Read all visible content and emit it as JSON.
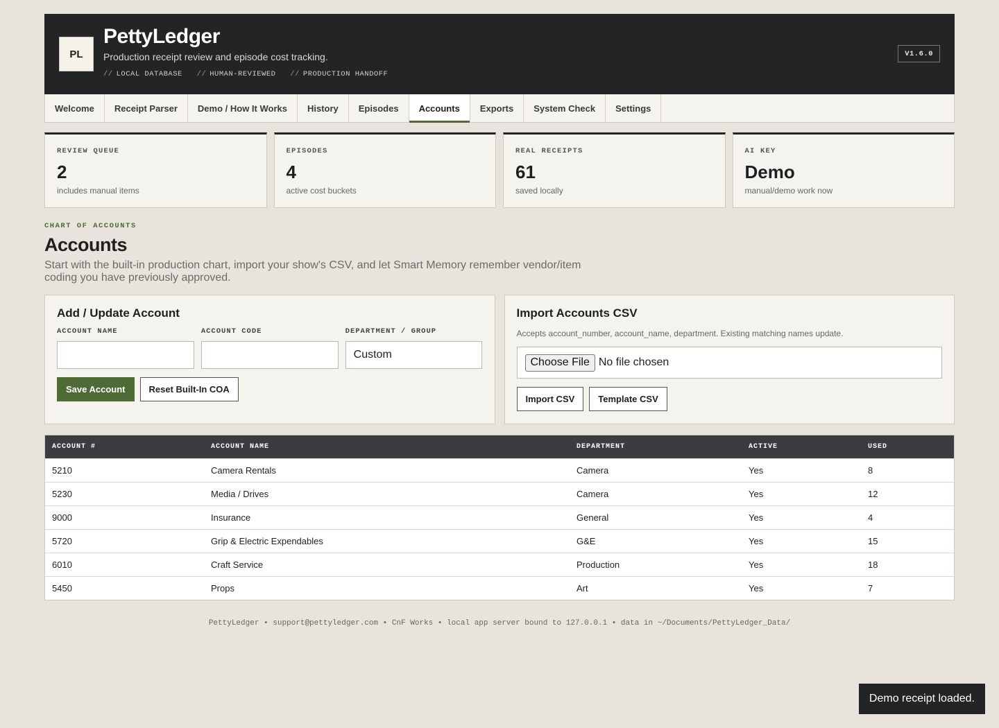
{
  "header": {
    "logo": "PL",
    "title": "PettyLedger",
    "subtitle": "Production receipt review and episode cost tracking.",
    "tags": [
      "LOCAL DATABASE",
      "HUMAN-REVIEWED",
      "PRODUCTION HANDOFF"
    ],
    "tag_prefix": "//",
    "version": "V1.6.0"
  },
  "nav": {
    "items": [
      "Welcome",
      "Receipt Parser",
      "Demo / How It Works",
      "History",
      "Episodes",
      "Accounts",
      "Exports",
      "System Check",
      "Settings"
    ],
    "active": "Accounts"
  },
  "stats": [
    {
      "label": "REVIEW QUEUE",
      "value": "2",
      "note": "includes manual items"
    },
    {
      "label": "EPISODES",
      "value": "4",
      "note": "active cost buckets"
    },
    {
      "label": "REAL RECEIPTS",
      "value": "61",
      "note": "saved locally"
    },
    {
      "label": "AI KEY",
      "value": "Demo",
      "note": "manual/demo work now"
    }
  ],
  "section": {
    "kicker": "CHART OF ACCOUNTS",
    "title": "Accounts",
    "description": "Start with the built-in production chart, import your show's CSV, and let Smart Memory remember vendor/item coding you have previously approved."
  },
  "add_panel": {
    "title": "Add / Update Account",
    "fields": [
      {
        "label": "ACCOUNT NAME",
        "value": ""
      },
      {
        "label": "ACCOUNT CODE",
        "value": ""
      },
      {
        "label": "DEPARTMENT / GROUP",
        "value": "Custom"
      }
    ],
    "save_label": "Save Account",
    "reset_label": "Reset Built-In COA"
  },
  "import_panel": {
    "title": "Import Accounts CSV",
    "note": "Accepts account_number, account_name, department. Existing matching names update.",
    "choose_label": "Choose File",
    "file_status": "No file chosen",
    "import_label": "Import CSV",
    "template_label": "Template CSV"
  },
  "table": {
    "headers": [
      "ACCOUNT #",
      "ACCOUNT NAME",
      "DEPARTMENT",
      "ACTIVE",
      "USED"
    ],
    "rows": [
      [
        "5210",
        "Camera Rentals",
        "Camera",
        "Yes",
        "8"
      ],
      [
        "5230",
        "Media / Drives",
        "Camera",
        "Yes",
        "12"
      ],
      [
        "9000",
        "Insurance",
        "General",
        "Yes",
        "4"
      ],
      [
        "5720",
        "Grip & Electric Expendables",
        "G&E",
        "Yes",
        "15"
      ],
      [
        "6010",
        "Craft Service",
        "Production",
        "Yes",
        "18"
      ],
      [
        "5450",
        "Props",
        "Art",
        "Yes",
        "7"
      ]
    ]
  },
  "footer": "PettyLedger • support@pettyledger.com • CnF Works • local app server bound to 127.0.0.1 • data in ~/Documents/PettyLedger_Data/",
  "toast": "Demo receipt loaded."
}
